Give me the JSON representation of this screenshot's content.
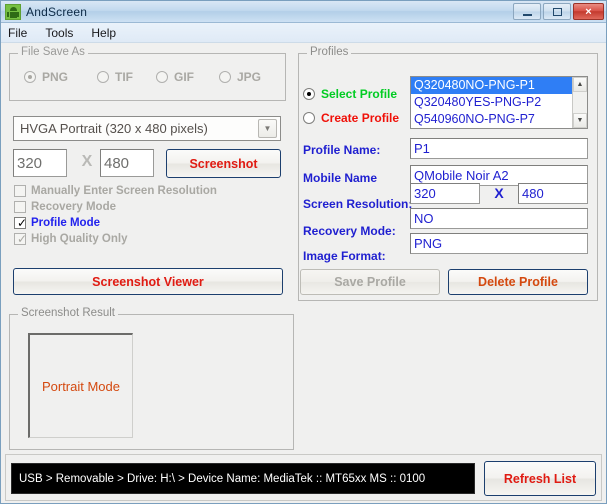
{
  "window": {
    "title": "AndScreen",
    "icon": "android-robot-icon",
    "controls": {
      "minimize": "minimize-button",
      "maximize": "maximize-button",
      "close": "×"
    }
  },
  "menubar": {
    "items": [
      {
        "label": "File"
      },
      {
        "label": "Tools"
      },
      {
        "label": "Help"
      }
    ]
  },
  "file_save_as": {
    "title": "File Save As",
    "enabled": false,
    "options": [
      {
        "label": "PNG",
        "selected": true
      },
      {
        "label": "TIF",
        "selected": false
      },
      {
        "label": "GIF",
        "selected": false
      },
      {
        "label": "JPG",
        "selected": false
      }
    ]
  },
  "resolution_combo": {
    "selected": "HVGA Portrait (320 x 480 pixels)",
    "arrow": "▼"
  },
  "resolution_inputs": {
    "width": "320",
    "separator": "X",
    "height": "480"
  },
  "screenshot_button": {
    "label": "Screenshot"
  },
  "checkboxes": [
    {
      "label": "Manually Enter Screen Resolution",
      "checked": false,
      "enabled": false
    },
    {
      "label": "Recovery Mode",
      "checked": false,
      "enabled": false
    },
    {
      "label": "Profile Mode",
      "checked": true,
      "enabled": true
    },
    {
      "label": "High Quality Only",
      "checked": true,
      "enabled": false
    }
  ],
  "viewer_button": {
    "label": "Screenshot Viewer"
  },
  "screenshot_result": {
    "title": "Screenshot Result",
    "preview_label": "Portrait Mode"
  },
  "profiles": {
    "title": "Profiles",
    "mode": [
      {
        "label": "Select Profile",
        "selected": true,
        "color": "#00cc22"
      },
      {
        "label": "Create Profile",
        "selected": false,
        "color": "#f01008"
      }
    ],
    "list": [
      {
        "label": "Q320480NO-PNG-P1",
        "selected": true
      },
      {
        "label": "Q320480YES-PNG-P2",
        "selected": false
      },
      {
        "label": "Q540960NO-PNG-P7",
        "selected": false
      }
    ],
    "scroll_up": "▲",
    "scroll_down": "▼",
    "fields": {
      "profile_name_label": "Profile Name:",
      "profile_name_value": "P1",
      "mobile_name_label": "Mobile Name",
      "mobile_name_value": "QMobile Noir A2",
      "screen_resolution_label": "Screen Resolution:",
      "screen_width": "320",
      "screen_separator": "X",
      "screen_height": "480",
      "recovery_mode_label": "Recovery Mode:",
      "recovery_mode_value": "NO",
      "image_format_label": "Image Format:",
      "image_format_value": "PNG"
    },
    "save_button": {
      "label": "Save Profile",
      "enabled": false
    },
    "delete_button": {
      "label": "Delete Profile",
      "enabled": true
    }
  },
  "status": {
    "text": "USB > Removable >  Drive: H:\\ >  Device Name: MediaTek :: MT65xx MS :: 0100"
  },
  "refresh_button": {
    "label": "Refresh List"
  },
  "colors": {
    "accent_red": "#e01b12",
    "field_blue": "#1f1fd0",
    "select_blue": "#2f7ef5",
    "green": "#00cc22",
    "orange": "#d4490f"
  }
}
